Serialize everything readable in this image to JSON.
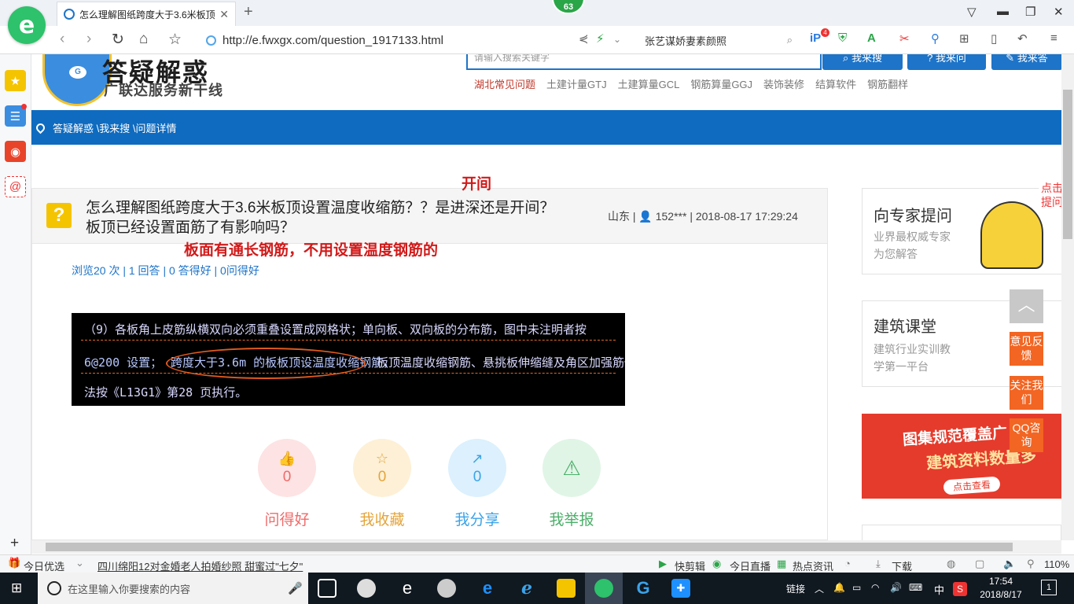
{
  "browser": {
    "tab_title": "怎么理解图纸跨度大于3.6米板顶",
    "tab_close": "✕",
    "new_tab": "+",
    "logo_letter": "e",
    "badge": "63",
    "url": "http://e.fwxgx.com/question_1917133.html",
    "search_text": "张艺谋娇妻素颜照",
    "ext_badge": "4"
  },
  "site": {
    "logo_title": "答疑解惑",
    "logo_subtitle": "广联达服务新干线",
    "mascot_letter": "G",
    "search_placeholder": "请输入搜索关键字",
    "buttons": [
      "我来搜",
      "我来问",
      "我来答"
    ],
    "hot_links": [
      "湖北常见问题",
      "土建计量GTJ",
      "土建算量GCL",
      "钢筋算量GGJ",
      "装饰装修",
      "结算软件",
      "钢筋翻样"
    ]
  },
  "breadcrumb": "答疑解惑 \\我来搜 \\问题详情",
  "question": {
    "icon": "?",
    "title": "怎么理解图纸跨度大于3.6米板顶设置温度收缩筋？？是进深还是开间？板顶已经设置面筋了有影响吗？",
    "meta": "山东 | 👤 152*** | 2018-08-17 17:29:24",
    "stats": "浏览20 次 | 1 回答 | 0 答得好 | 0问得好"
  },
  "annotations": {
    "top": "开间",
    "middle": "板面有通长钢筋，不用设置温度钢筋的"
  },
  "cad_text": {
    "line1": "（9）各板角上皮筋纵横双向必须重叠设置成网格状；单向板、双向板的分布筋，图中未注明者按",
    "line2a": "6@200 设置；",
    "line2b": "跨度大于3.6m 的板板顶设温度收缩钢筋，",
    "line2c": "板顶温度收缩钢筋、悬挑板伸缩缝及角区加强筋做",
    "line3": "法按《L13G1》第28 页执行。"
  },
  "actions": [
    {
      "icon": "👍",
      "count": "0",
      "label": "问得好",
      "color": "#f06a6a",
      "bg": "#fde3e3"
    },
    {
      "icon": "☆",
      "count": "0",
      "label": "我收藏",
      "color": "#e5a53a",
      "bg": "#fdf0d6"
    },
    {
      "icon": "↗",
      "count": "0",
      "label": "我分享",
      "color": "#3ba3e8",
      "bg": "#dcf0fd"
    },
    {
      "icon": "⚠",
      "count": "0",
      "label": "我举报",
      "color": "#4caf6a",
      "bg": "#e0f5e6"
    }
  ],
  "right": {
    "expert_title": "向专家提问",
    "expert_sub1": "业界最权威专家",
    "expert_sub2": "为您解答",
    "expert_tag": "点击提问",
    "class_title": "建筑课堂",
    "class_sub1": "建筑行业实训教",
    "class_sub2": "学第一平台",
    "promo_l1": "图集规范覆盖广",
    "promo_l2": "建筑资料数量多",
    "promo_l3": "点击查看",
    "float_back": "︿",
    "float_feedback": "意见反馈",
    "float_follow": "关注我们",
    "float_qq": "QQ咨询"
  },
  "statusbar": {
    "left1": "今日优选",
    "news": "四川绵阳12对金婚老人拍婚纱照 甜蜜过\"七夕\"",
    "items": [
      "快剪辑",
      "今日直播",
      "热点资讯",
      "下载"
    ],
    "zoom": "110%"
  },
  "taskbar": {
    "search_placeholder": "在这里输入你要搜索的内容",
    "tray_link": "链接",
    "ime": "中",
    "time": "17:54",
    "date": "2018/8/17",
    "notif": "1"
  }
}
